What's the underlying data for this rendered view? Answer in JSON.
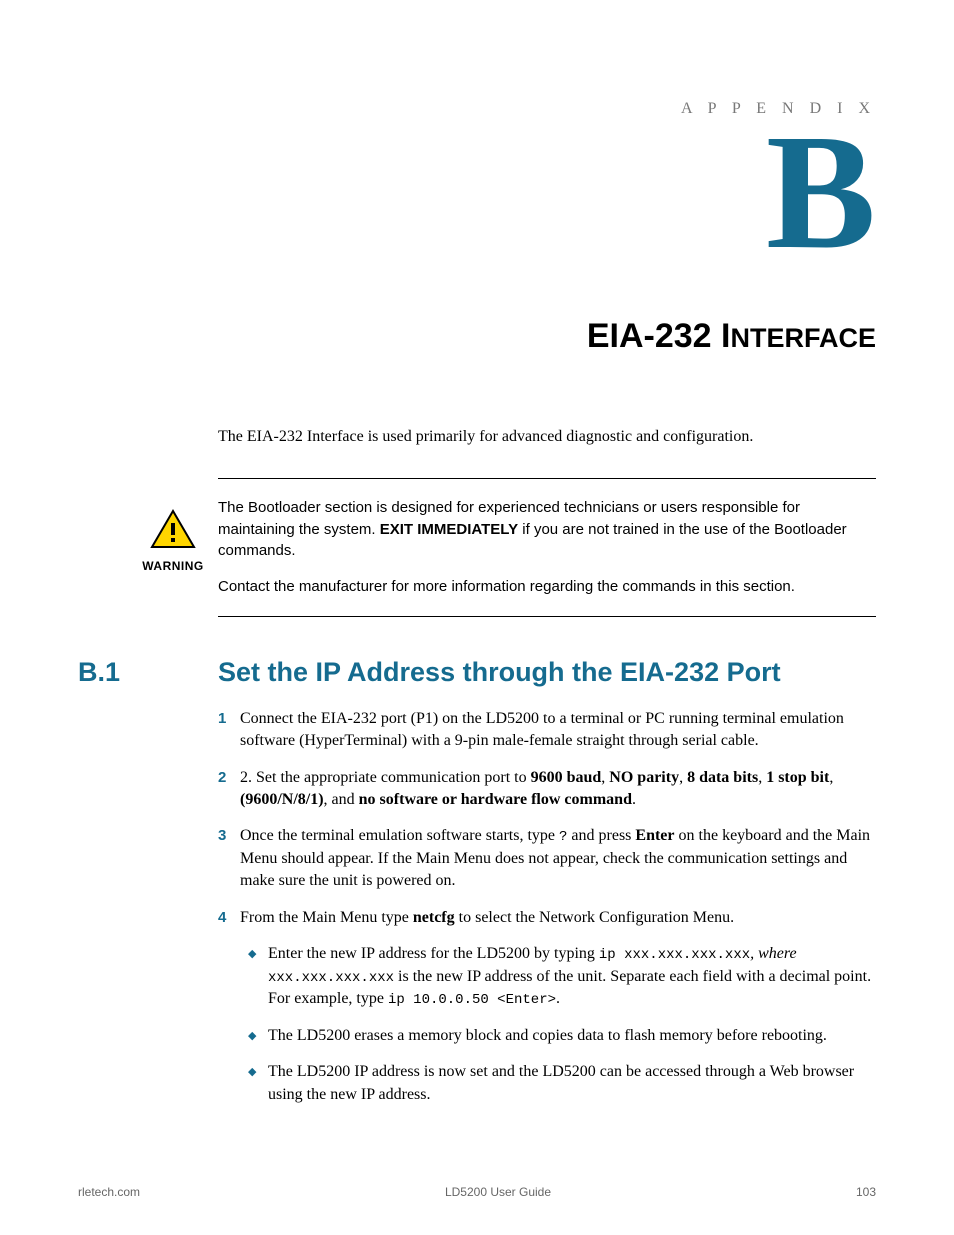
{
  "header": {
    "appendix_label": "A P P E N D I X",
    "letter": "B"
  },
  "chapter": {
    "title_main": "EIA-232 I",
    "title_sc": "NTERFACE"
  },
  "intro": "The EIA-232 Interface is used primarily for advanced diagnostic and configuration.",
  "warning": {
    "label": "WARNING",
    "p1_pre": "The Bootloader section is designed for experienced technicians or users responsible for maintaining the system. ",
    "p1_bold": "EXIT IMMEDIATELY",
    "p1_post": " if you are not trained in the use of the Bootloader commands.",
    "p2": "Contact the manufacturer for more information regarding the commands in this section."
  },
  "section": {
    "number": "B.1",
    "title": "Set the IP Address through the EIA-232 Port"
  },
  "steps": [
    {
      "n": "1",
      "text": "Connect the EIA-232 port (P1) on the LD5200 to a terminal or PC running terminal emulation software (HyperTerminal) with a 9-pin male-female straight through serial cable."
    },
    {
      "n": "2",
      "pre": "2. Set the appropriate communication port to ",
      "b1": "9600 baud",
      "c1": ", ",
      "b2": "NO parity",
      "c2": ", ",
      "b3": "8 data bits",
      "c3": ", ",
      "b4": "1 stop bit",
      "c4": ", ",
      "b5": "(9600/N/8/1)",
      "c5": ", and ",
      "b6": "no software or hardware flow command",
      "post": "."
    },
    {
      "n": "3",
      "pre": "Once the terminal emulation software starts, type ",
      "code": "?",
      "mid": " and press ",
      "bold": "Enter",
      "post": " on the keyboard and the Main Menu should appear. If the Main Menu does not appear, check the communication settings and make sure the unit is powered on."
    },
    {
      "n": "4",
      "pre": "From the Main Menu type ",
      "bold": "netcfg",
      "post": " to select the Network Configuration Menu."
    }
  ],
  "sub": [
    {
      "pre": "Enter the new IP address for the LD5200 by typing ",
      "code1": "ip xxx.xxx.xxx.xxx",
      "mid1": ", where ",
      "code2": "xxx.xxx.xxx.xxx",
      "mid2": " is the new IP address of the unit. Separate each field with a decimal point. For example, type ",
      "code3": "ip 10.0.0.50 <Enter>",
      "post": "."
    },
    {
      "text": "The LD5200 erases a memory block and copies data to flash memory before rebooting."
    },
    {
      "text": "The LD5200 IP address is now set and the LD5200 can be accessed through a Web browser using the new IP address."
    }
  ],
  "footer": {
    "left": "rletech.com",
    "center": "LD5200 User Guide",
    "right": "103"
  }
}
